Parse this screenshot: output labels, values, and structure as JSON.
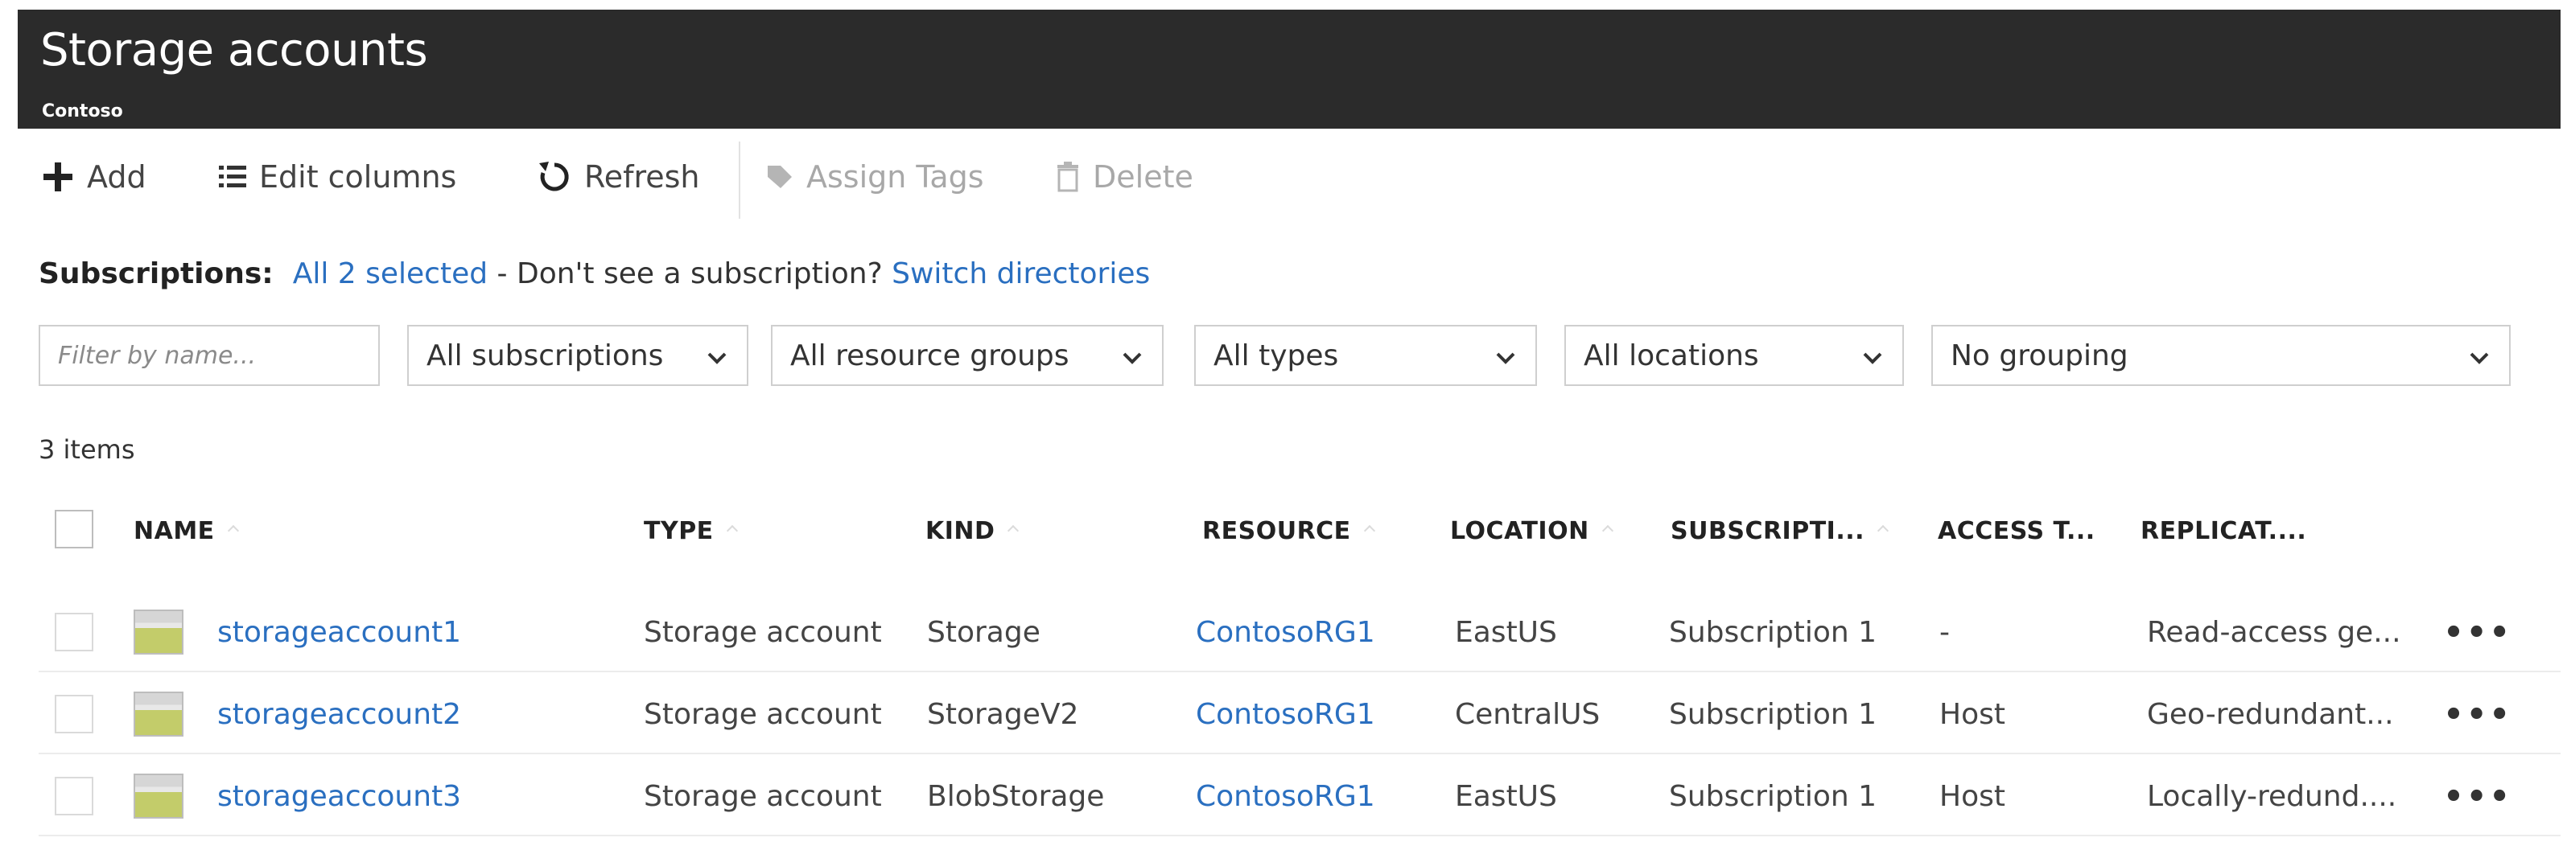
{
  "header": {
    "title": "Storage accounts",
    "subtitle": "Contoso"
  },
  "toolbar": {
    "add": "Add",
    "edit_columns": "Edit columns",
    "refresh": "Refresh",
    "assign_tags": "Assign Tags",
    "delete": "Delete"
  },
  "subscriptions": {
    "label": "Subscriptions:",
    "selected": "All 2 selected",
    "middle": " - Don't see a subscription? ",
    "switch": "Switch directories"
  },
  "filters": {
    "name_placeholder": "Filter by name...",
    "subscriptions": "All subscriptions",
    "resource_groups": "All resource groups",
    "types": "All types",
    "locations": "All locations",
    "grouping": "No grouping"
  },
  "count": "3 items",
  "columns": {
    "name": "NAME",
    "type": "TYPE",
    "kind": "KIND",
    "resource": "RESOURCE",
    "location": "LOCATION",
    "subscription": "SUBSCRIPTI...",
    "access": "ACCESS T...",
    "replication": "REPLICAT...."
  },
  "rows": [
    {
      "name": "storageaccount1",
      "type": "Storage account",
      "kind": "Storage",
      "resource": "ContosoRG1",
      "location": "EastUS",
      "subscription": "Subscription 1",
      "access": "-",
      "replication": "Read-access ge..."
    },
    {
      "name": "storageaccount2",
      "type": "Storage account",
      "kind": "StorageV2",
      "resource": "ContosoRG1",
      "location": "CentralUS",
      "subscription": "Subscription 1",
      "access": "Host",
      "replication": "Geo-redundant..."
    },
    {
      "name": "storageaccount3",
      "type": "Storage account",
      "kind": "BlobStorage",
      "resource": "ContosoRG1",
      "location": "EastUS",
      "subscription": "Subscription 1",
      "access": "Host",
      "replication": "Locally-redund...."
    }
  ],
  "more_glyph": "•••",
  "colors": {
    "titlebar": "#2b2b2b",
    "link": "#2a6fc0",
    "disabled": "#a8a8a8"
  }
}
